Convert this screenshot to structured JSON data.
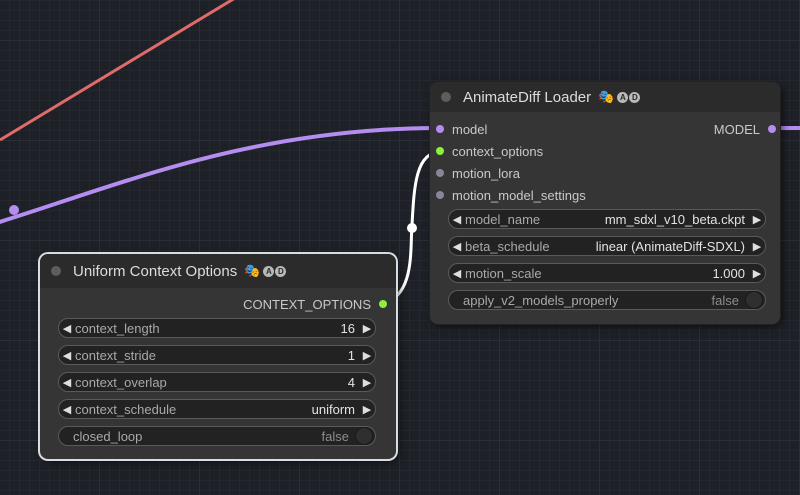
{
  "colors": {
    "canvas_bg": "#1d2127",
    "node_body": "#353535",
    "node_title_bar": "#2b2b2b",
    "link_model": "#b58cf0",
    "link_latent": "#e06b6b",
    "link_context": "#ffffff",
    "slot_model": "#b58cf0",
    "slot_context_options": "#8cf03c",
    "slot_unconnected": "#8a8699"
  },
  "loader_node": {
    "title": "AnimateDiff Loader",
    "badge_icons": [
      "theater-masks-icon",
      "a-badge-icon",
      "d-badge-icon"
    ],
    "badge_letters": [
      "A",
      "D"
    ],
    "inputs": [
      {
        "label": "model",
        "connected": true,
        "color": "#b58cf0"
      },
      {
        "label": "context_options",
        "connected": true,
        "color": "#8cf03c"
      },
      {
        "label": "motion_lora",
        "connected": false,
        "color": "#8a8699"
      },
      {
        "label": "motion_model_settings",
        "connected": false,
        "color": "#8a8699"
      }
    ],
    "output": {
      "label": "MODEL",
      "color": "#b58cf0"
    },
    "widgets": [
      {
        "label": "model_name",
        "value": "mm_sdxl_v10_beta.ckpt"
      },
      {
        "label": "beta_schedule",
        "value": "linear (AnimateDiff-SDXL)"
      },
      {
        "label": "motion_scale",
        "value": "1.000"
      }
    ],
    "toggle": {
      "label": "apply_v2_models_properly",
      "value": "false"
    }
  },
  "context_node": {
    "title": "Uniform Context Options",
    "badge_icons": [
      "theater-masks-icon",
      "a-badge-icon",
      "d-badge-icon"
    ],
    "badge_letters": [
      "A",
      "D"
    ],
    "output": {
      "label": "CONTEXT_OPTIONS",
      "color": "#8cf03c"
    },
    "widgets": [
      {
        "label": "context_length",
        "value": "16"
      },
      {
        "label": "context_stride",
        "value": "1"
      },
      {
        "label": "context_overlap",
        "value": "4"
      },
      {
        "label": "context_schedule",
        "value": "uniform"
      }
    ],
    "toggle": {
      "label": "closed_loop",
      "value": "false"
    }
  },
  "arrow_left": "◀",
  "arrow_right": "▶"
}
